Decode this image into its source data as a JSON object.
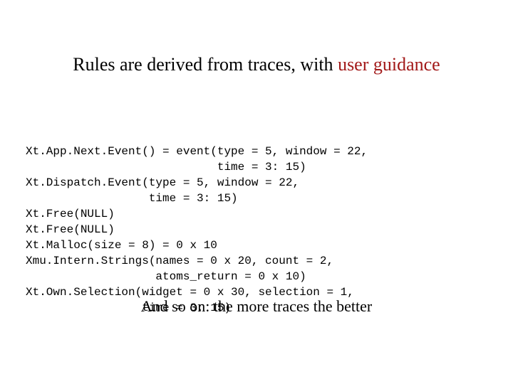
{
  "title": {
    "plain": "Rules are derived from traces, with ",
    "accent": "user guidance"
  },
  "code": {
    "lines": [
      "Xt.App.Next.Event() = event(type = 5, window = 22,",
      "                            time = 3: 15)",
      "Xt.Dispatch.Event(type = 5, window = 22,",
      "                  time = 3: 15)",
      "Xt.Free(NULL)",
      "Xt.Free(NULL)",
      "Xt.Malloc(size = 8) = 0 x 10",
      "Xmu.Intern.Strings(names = 0 x 20, count = 2,",
      "                   atoms_return = 0 x 10)",
      "Xt.Own.Selection(widget = 0 x 30, selection = 1,",
      "                 time = 3: 15)"
    ]
  },
  "footer": "And so on: the more traces the better"
}
